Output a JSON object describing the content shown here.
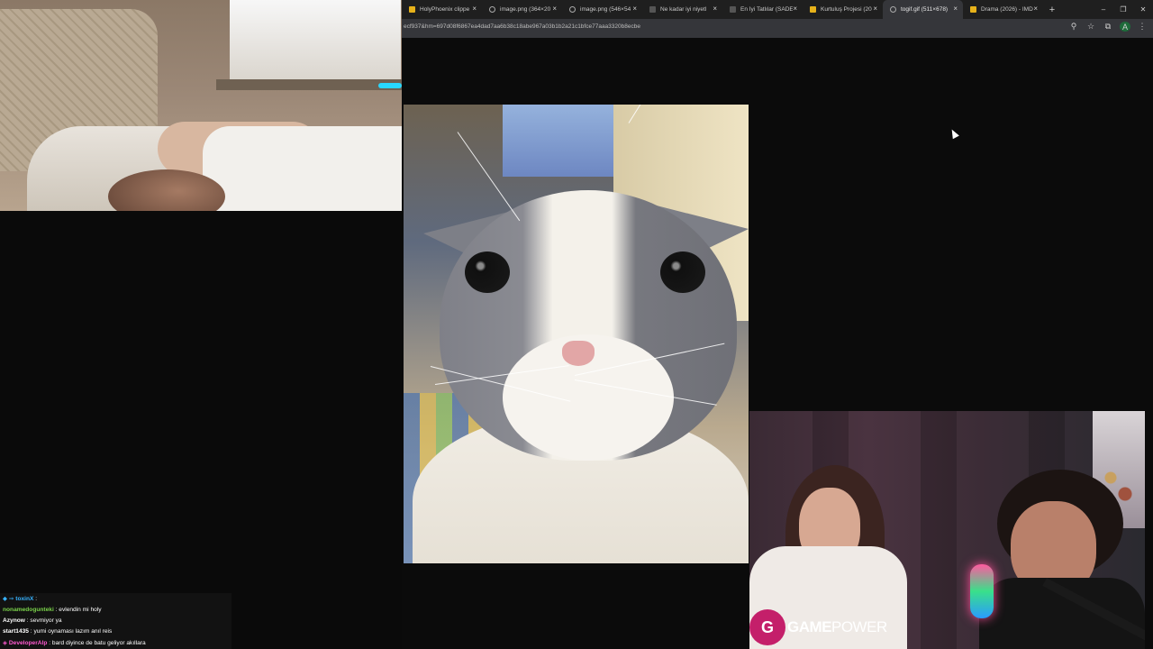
{
  "browser": {
    "tabs": [
      {
        "label": "HolyPhoenix clippe",
        "favicon_color": "#e7b21a",
        "active": false
      },
      {
        "label": "image.png (364×20",
        "favicon_color": "globe",
        "active": false
      },
      {
        "label": "image.png (546×54",
        "favicon_color": "globe",
        "active": false
      },
      {
        "label": "Ne kadar iyi niyetl",
        "favicon_color": "#555555",
        "active": false
      },
      {
        "label": "En İyi Tatlılar (SADE",
        "favicon_color": "#555555",
        "active": false
      },
      {
        "label": "Kurtuluş Projesi (20",
        "favicon_color": "#e7b21a",
        "active": false
      },
      {
        "label": "togif.gif (511×678)",
        "favicon_color": "globe",
        "active": true
      },
      {
        "label": "Drama (2026) - IMD",
        "favicon_color": "#e7b21a",
        "active": false
      }
    ],
    "new_tab_glyph": "+",
    "close_glyph": "×",
    "window_controls": {
      "minimize": "–",
      "restore": "❐",
      "close": "✕"
    },
    "url": "ecf937&hm=697d08f6867ea4dad7aa6b38c18abe967a03b1b2a21c1bfce77aaa3320b8ecbe",
    "address_icons": {
      "zoom": "⚲",
      "bookmark": "☆",
      "extensions": "⧉",
      "profile_initial": "A",
      "menu": "⋮"
    }
  },
  "overlay": {
    "logo_mark": "G",
    "logo_word_a": "GAME",
    "logo_word_b": "POWER",
    "brand_color": "#c41f6a"
  },
  "chat": {
    "messages": [
      {
        "user": "toxinX",
        "prefix": "◆ ⇒ ",
        "text": " : ",
        "user_color": "#37b3ff"
      },
      {
        "user": "nonamedogunteki",
        "prefix": "",
        "text": " : evlendin mi holy",
        "user_color": "#7ad14a"
      },
      {
        "user": "Azynow",
        "prefix": "",
        "text": " : sevmiyor ya",
        "user_color": "#ffffff"
      },
      {
        "user": "start1435",
        "prefix": "",
        "text": " : yumi oynaması lazım anıl reis",
        "user_color": "#ffffff"
      },
      {
        "user": "DeveloperAlp",
        "prefix": "◈ ",
        "text": " : bard diyince de batu geliyor akıllara",
        "user_color": "#ff5ad1"
      }
    ]
  }
}
